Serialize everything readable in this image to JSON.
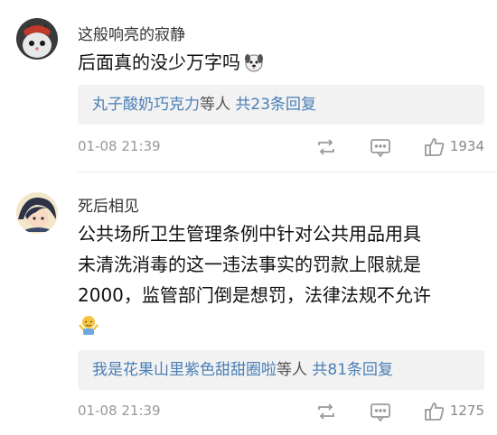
{
  "comments": [
    {
      "username": "这般响亮的寂静",
      "text": "后面真的没少万字吗",
      "emoji_icon": "dog-face-icon",
      "reply_summary": {
        "users": "丸子酸奶巧克力",
        "suffix": "等人",
        "count_text": "共23条回复"
      },
      "time": "01-08 21:39",
      "likes": "1934"
    },
    {
      "username": "死后相见",
      "text_lines": [
        "公共场所卫生管理条例中针对公共用品用具",
        "未清洗消毒的这一违法事实的罚款上限就是",
        "2000，监管部门倒是想罚，法律法规不允许"
      ],
      "emoji_icon": "shrug-emoji-icon",
      "reply_summary": {
        "users": "我是花果山里紫色甜甜圈啦",
        "suffix": "等人",
        "count_text": "共81条回复"
      },
      "time": "01-08 21:39",
      "likes": "1275"
    }
  ],
  "colors": {
    "link": "#4a7fb5",
    "reply_bg": "#f2f2f2",
    "meta": "#999999",
    "icon": "#9a9a9a"
  }
}
